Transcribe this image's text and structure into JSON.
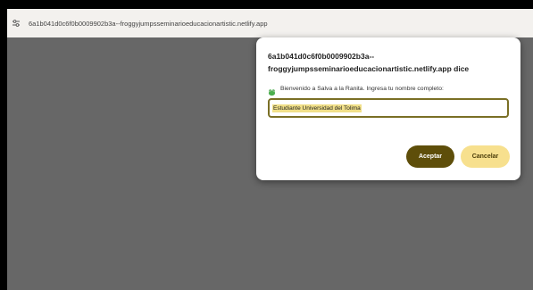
{
  "address_bar": {
    "site_icon": "site-settings-icon",
    "url": "6a1b041d0c6f0b0009902b3a--froggyjumpsseminarioeducacionartistic.netlify.app"
  },
  "dialog": {
    "title_line1": "6a1b041d0c6f0b0009902b3a--",
    "title_line2": "froggyjumpsseminarioeducacionartistic.netlify.app dice",
    "prompt_icon": "frog-icon",
    "prompt_text": "Bienvenido a Salva a la Ranita. Ingresa tu nombre completo:",
    "input_value": "Estudiante Universidad del Tolima",
    "accept_label": "Aceptar",
    "cancel_label": "Cancelar"
  },
  "colors": {
    "backdrop": "#676767",
    "accept_bg": "#5e4e0a",
    "cancel_bg": "#f7e08e",
    "input_border": "#7a6f25",
    "selection": "#f1e089"
  }
}
